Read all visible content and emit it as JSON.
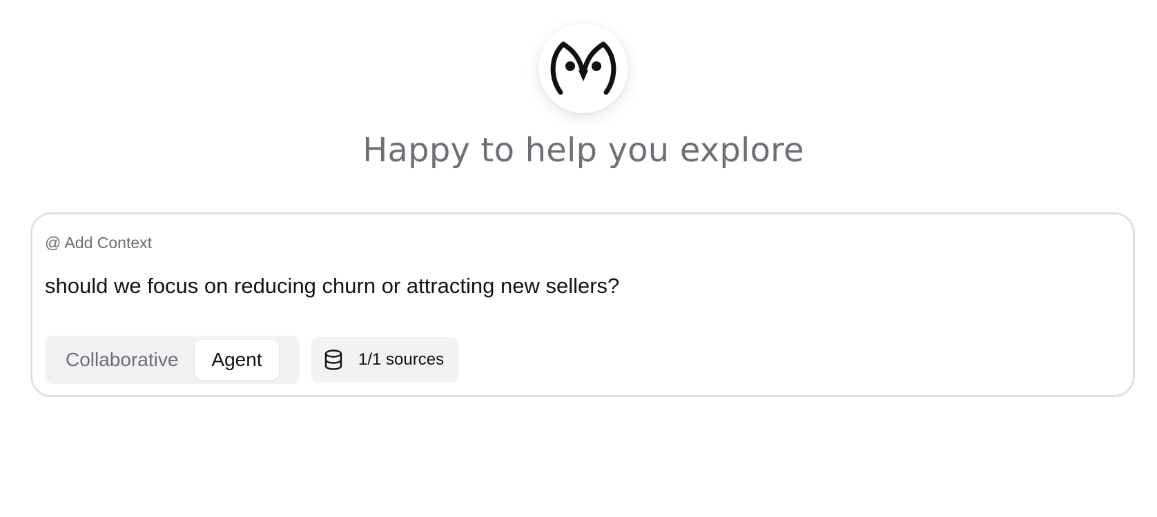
{
  "header": {
    "headline": "Happy to help you explore"
  },
  "composer": {
    "add_context_label": "@ Add Context",
    "query_value": "should we focus on reducing churn or attracting new sellers?",
    "modes": [
      {
        "label": "Collaborative",
        "selected": false
      },
      {
        "label": "Agent",
        "selected": true
      }
    ],
    "sources_label": "1/1 sources",
    "sources_icon": "database-icon"
  },
  "colors": {
    "headline": "#6e6e75",
    "border": "#e1e1e4",
    "chip_bg": "#f2f2f4",
    "text": "#111111"
  }
}
